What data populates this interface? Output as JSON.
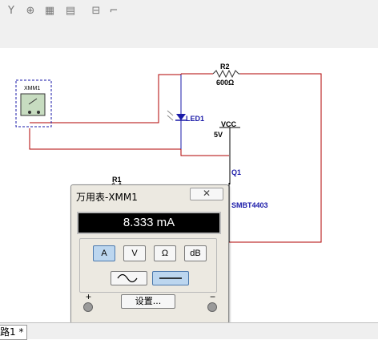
{
  "window": {
    "tab_label": "路1 *"
  },
  "toolbar": {
    "sim_buttons": [
      "play",
      "pause",
      "stop"
    ]
  },
  "schematic": {
    "r2": {
      "ref": "R2",
      "value": "600Ω"
    },
    "led": {
      "ref": "LED1"
    },
    "vcc": {
      "ref": "VCC",
      "value": "5V"
    },
    "q1": {
      "ref": "Q1",
      "model": "SMBT4403"
    },
    "r1": {
      "ref": "R1"
    },
    "xmm_label": "XMM1"
  },
  "multimeter": {
    "title": "万用表-XMM1",
    "close_symbol": "✕",
    "reading": "8.333 mA",
    "mode_buttons": [
      "A",
      "V",
      "Ω",
      "dB"
    ],
    "active_mode": "A",
    "active_wave": "DC",
    "settings_label": "设置...",
    "plus_label": "+",
    "minus_label": "−"
  },
  "colors": {
    "wire": "#b00000",
    "part": "#1a1aa8",
    "stop": "#cc0000",
    "active": "#bcd6ef"
  }
}
